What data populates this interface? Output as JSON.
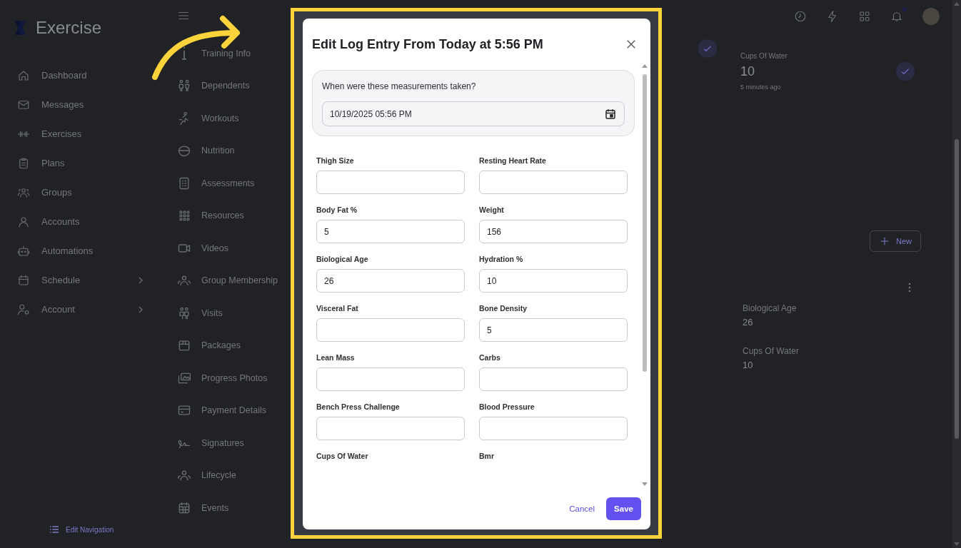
{
  "app": {
    "logo": "Exercise"
  },
  "sidebar": {
    "items": [
      {
        "label": "Dashboard",
        "expandable": false
      },
      {
        "label": "Messages",
        "expandable": false
      },
      {
        "label": "Exercises",
        "expandable": false
      },
      {
        "label": "Plans",
        "expandable": false
      },
      {
        "label": "Groups",
        "expandable": false
      },
      {
        "label": "Accounts",
        "expandable": false
      },
      {
        "label": "Automations",
        "expandable": false
      },
      {
        "label": "Schedule",
        "expandable": true
      },
      {
        "label": "Account",
        "expandable": true
      }
    ],
    "edit_navigation": "Edit Navigation"
  },
  "subnav": {
    "items": [
      "Training Info",
      "Dependents",
      "Workouts",
      "Nutrition",
      "Assessments",
      "Resources",
      "Videos",
      "Group Membership",
      "Visits",
      "Packages",
      "Progress Photos",
      "Payment Details",
      "Signatures",
      "Lifecycle",
      "Events"
    ]
  },
  "content": {
    "stat_card": {
      "label": "Cups Of Water",
      "value": "10",
      "time": "5 minutes ago"
    },
    "new_button": "New",
    "details": [
      {
        "label": "Biological Age",
        "value": "26"
      },
      {
        "label": "Cups Of Water",
        "value": "10"
      }
    ]
  },
  "dialog": {
    "title": "Edit Log Entry From Today at 5:56 PM",
    "date_question": "When were these measurements taken?",
    "date_value": "10/19/2025 05:56 PM",
    "fields": [
      {
        "label": "Thigh Size",
        "kind": "field"
      },
      {
        "label": "Resting Heart Rate",
        "kind": "field"
      },
      {
        "label": "Body Fat %",
        "kind": "field",
        "value": "5"
      },
      {
        "label": "Weight",
        "kind": "field",
        "value": "156"
      },
      {
        "label": "Biological Age",
        "kind": "field",
        "value": "26"
      },
      {
        "label": "Hydration %",
        "kind": "field",
        "value": "10"
      },
      {
        "label": "Visceral Fat",
        "kind": "field"
      },
      {
        "label": "Bone Density",
        "kind": "field",
        "value": "5"
      },
      {
        "label": "Lean Mass",
        "kind": "field"
      },
      {
        "label": "Carbs",
        "kind": "field"
      },
      {
        "label": "Bench Press Challenge",
        "kind": "field"
      },
      {
        "label": "Blood Pressure",
        "kind": "field"
      },
      {
        "label": "Cups Of Water",
        "kind": "cut"
      },
      {
        "label": "Bmr",
        "kind": "cut"
      }
    ],
    "cancel": "Cancel",
    "save": "Save"
  }
}
